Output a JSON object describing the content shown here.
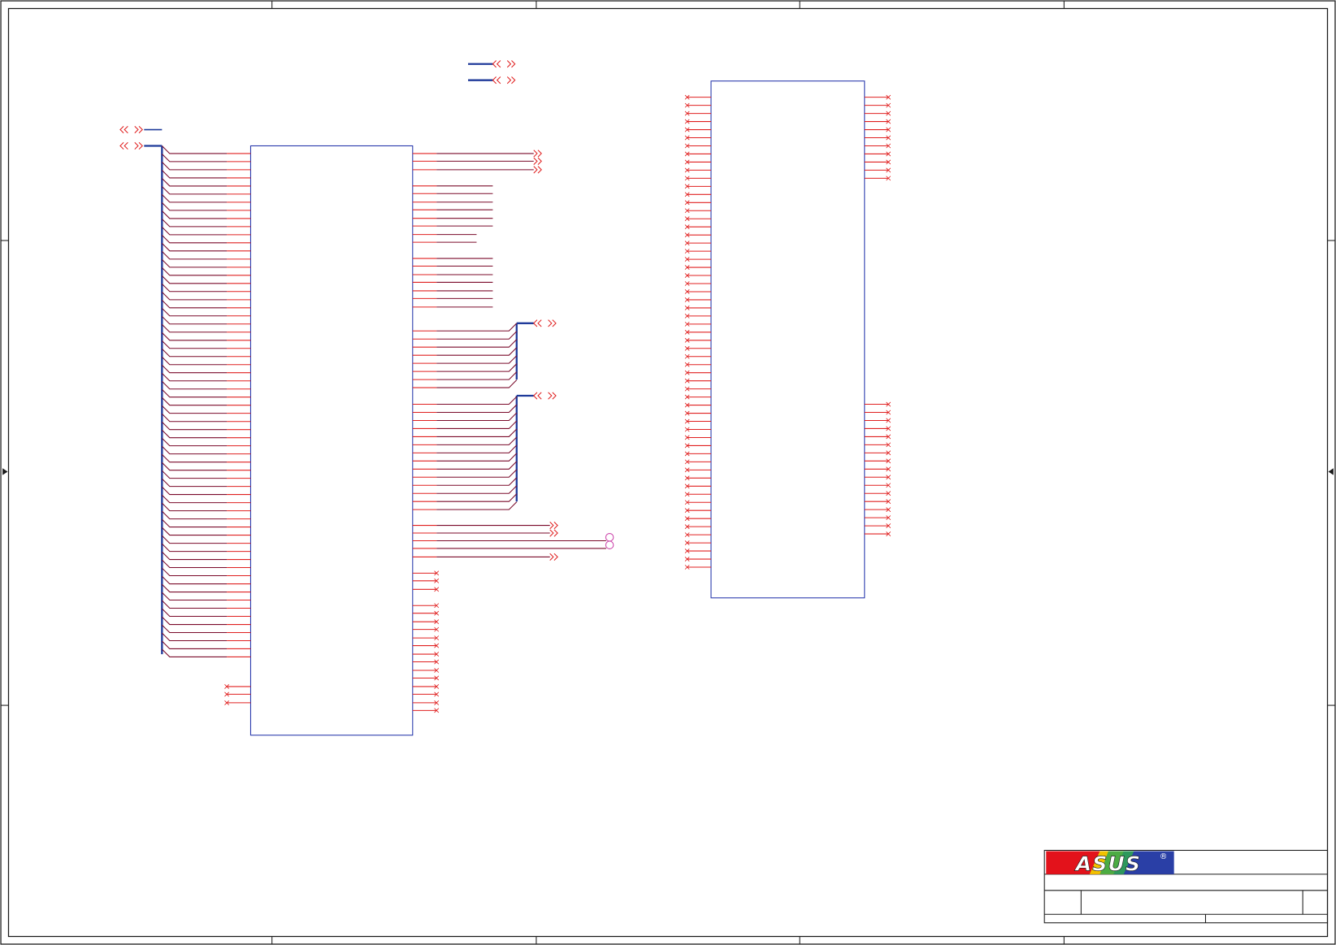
{
  "title_block": {
    "logo_text": "ASUS",
    "registered_mark": "®"
  },
  "colors": {
    "frame": "#1a1a1a",
    "component_outline": "#2233aa",
    "pin": "#e02020",
    "net_wire": "#7a0a2a",
    "bus": "#1f3a9a",
    "test_point": "#cc44aa",
    "logo_red": "#e3121b",
    "logo_blue": "#2a3fa6"
  },
  "connectors": {
    "offpage_top": [
      "offpage-connector-1",
      "offpage-connector-2"
    ],
    "offpage_left": [
      "offpage-connector-3",
      "offpage-connector-4"
    ],
    "offpage_right": [
      "offpage-connector-5",
      "offpage-connector-6"
    ]
  }
}
